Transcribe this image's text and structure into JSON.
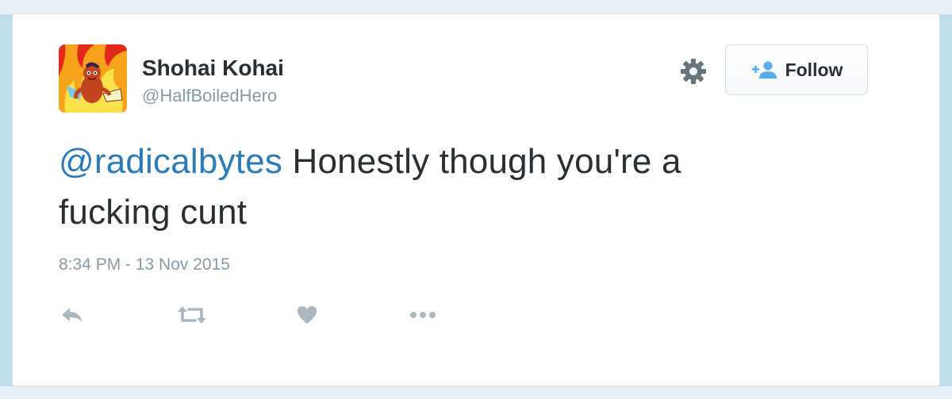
{
  "tweet": {
    "author": {
      "display_name": "Shohai Kohai",
      "handle": "@HalfBoiledHero",
      "avatar_icon": "flaming-character-avatar"
    },
    "text": {
      "mention": "@radicalbytes",
      "body_line1": " Honestly though you're a",
      "body_line2": "fucking cunt"
    },
    "timestamp": "8:34 PM - 13 Nov 2015",
    "actions": {
      "reply_icon": "reply-icon",
      "retweet_icon": "retweet-icon",
      "like_icon": "heart-icon",
      "more_icon": "more-icon"
    }
  },
  "header": {
    "settings_icon": "gear-icon",
    "follow_label": "Follow",
    "follow_icon": "add-user-icon"
  },
  "colors": {
    "mention": "#2b7bb9",
    "text": "#292f33",
    "muted": "#8899a6",
    "icon": "#aab8c2",
    "follow_icon": "#55acee",
    "background": "#c0deed"
  }
}
